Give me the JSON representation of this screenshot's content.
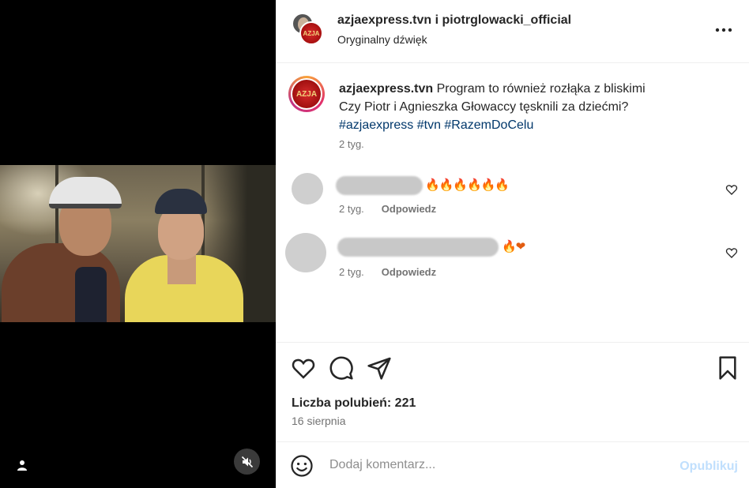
{
  "header": {
    "title_user1": "azjaexpress.tvn",
    "title_connector": " i ",
    "title_user2": "piotrglowacki_official",
    "audio_label": "Oryginalny dźwięk",
    "more_icon": "more-horizontal-icon"
  },
  "caption": {
    "username": "azjaexpress.tvn",
    "line1": " Program to również rozłąka z bliskimi",
    "line2": "Czy Piotr i Agnieszka Głowaccy tęsknili za dziećmi?",
    "hashtags": "#azjaexpress #tvn #RazemDoCelu",
    "time": "2 tyg."
  },
  "comments": [
    {
      "emoji": "🔥🔥🔥🔥🔥🔥",
      "time": "2 tyg.",
      "reply_label": "Odpowiedz"
    },
    {
      "emoji": "🔥❤",
      "time": "2 tyg.",
      "reply_label": "Odpowiedz"
    }
  ],
  "actions": {
    "likes": "Liczba polubień: 221",
    "date": "16 sierpnia"
  },
  "comment_bar": {
    "placeholder": "Dodaj komentarz...",
    "publish_label": "Opublikuj"
  },
  "media": {
    "avatar_badge": "AZJA"
  },
  "colors": {
    "hashtag": "#00376b",
    "secondary_text": "#737373",
    "publish_disabled": "#c0dffd",
    "media_bg": "#000000"
  }
}
